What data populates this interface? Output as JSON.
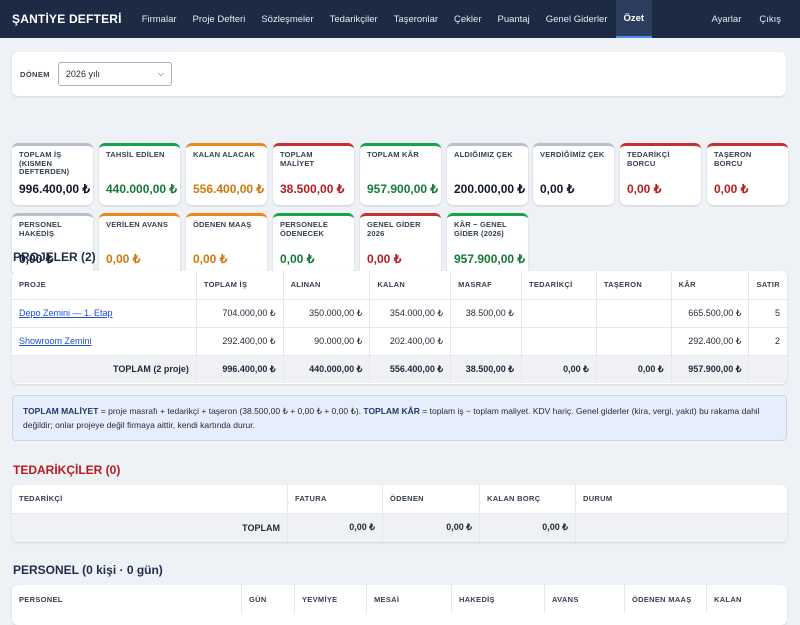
{
  "nav": {
    "brand": "ŞANTİYE DEFTERİ",
    "items": [
      "Firmalar",
      "Proje Defteri",
      "Sözleşmeler",
      "Tedarikçiler",
      "Taşeronlar",
      "Çekler",
      "Puantaj",
      "Genel Giderler",
      "Özet"
    ],
    "active": "Özet",
    "right": [
      "Ayarlar",
      "Çıkış"
    ]
  },
  "filter": {
    "label": "DÖNEM",
    "value": "2026 yılı"
  },
  "stats": [
    {
      "label": "TOPLAM İŞ (KISMEN DEFTERDEN)",
      "value": "996.400,00 ₺",
      "tone": "neutral"
    },
    {
      "label": "TAHSİL EDİLEN",
      "value": "440.000,00 ₺",
      "tone": "green"
    },
    {
      "label": "KALAN ALACAK",
      "value": "556.400,00 ₺",
      "tone": "orange"
    },
    {
      "label": "TOPLAM MALİYET",
      "value": "38.500,00 ₺",
      "tone": "red"
    },
    {
      "label": "TOPLAM KÂR",
      "value": "957.900,00 ₺",
      "tone": "green"
    },
    {
      "label": "ALDIĞIMIZ ÇEK",
      "value": "200.000,00 ₺",
      "tone": "neutral"
    },
    {
      "label": "VERDİĞİMİZ ÇEK",
      "value": "0,00 ₺",
      "tone": "neutral"
    },
    {
      "label": "TEDARİKÇİ BORCU",
      "value": "0,00 ₺",
      "tone": "red"
    },
    {
      "label": "TAŞERON BORCU",
      "value": "0,00 ₺",
      "tone": "red"
    },
    {
      "label": "PERSONEL HAKEDİŞ",
      "value": "0,00 ₺",
      "tone": "neutral"
    },
    {
      "label": "VERİLEN AVANS",
      "value": "0,00 ₺",
      "tone": "orange"
    },
    {
      "label": "ÖDENEN MAAŞ",
      "value": "0,00 ₺",
      "tone": "orange"
    },
    {
      "label": "PERSONELE ÖDENECEK",
      "value": "0,00 ₺",
      "tone": "green"
    },
    {
      "label": "GENEL GİDER 2026",
      "value": "0,00 ₺",
      "tone": "red"
    },
    {
      "label": "KÂR − GENEL GİDER (2026)",
      "value": "957.900,00 ₺",
      "tone": "green"
    }
  ],
  "projects": {
    "title": "PROJELER (2)",
    "columns": [
      "PROJE",
      "TOPLAM İŞ",
      "ALINAN",
      "KALAN",
      "MASRAF",
      "TEDARİKÇİ",
      "TAŞERON",
      "KÂR",
      "SATIR"
    ],
    "rows": [
      [
        "Depo Zemini — 1. Etap",
        "704.000,00 ₺",
        "350.000,00 ₺",
        "354.000,00 ₺",
        "38.500,00 ₺",
        "",
        "",
        "665.500,00 ₺",
        "5"
      ],
      [
        "Showroom Zemini",
        "292.400,00 ₺",
        "90.000,00 ₺",
        "202.400,00 ₺",
        "",
        "",
        "",
        "292.400,00 ₺",
        "2"
      ]
    ],
    "total": [
      "TOPLAM (2 proje)",
      "996.400,00 ₺",
      "440.000,00 ₺",
      "556.400,00 ₺",
      "38.500,00 ₺",
      "0,00 ₺",
      "0,00 ₺",
      "957.900,00 ₺",
      ""
    ]
  },
  "note": {
    "b1": "TOPLAM MALİYET",
    "t1": " = proje masrafı + tedarikçi + taşeron (38.500,00 ₺ + 0,00 ₺ + 0,00 ₺). ",
    "b2": "TOPLAM KÂR",
    "t2": " = toplam iş − toplam maliyet. KDV hariç. Genel giderler (kira, vergi, yakıt) bu rakama dahil değildir; onlar projeye değil firmaya aittir, kendi kartında durur."
  },
  "suppliers": {
    "title": "TEDARİKÇİLER (0)",
    "columns": [
      "TEDARİKÇİ",
      "FATURA",
      "ÖDENEN",
      "KALAN BORÇ",
      "DURUM"
    ],
    "total": [
      "TOPLAM",
      "0,00 ₺",
      "0,00 ₺",
      "0,00 ₺",
      ""
    ]
  },
  "personnel": {
    "title": "PERSONEL (0 kişi · 0 gün)",
    "columns": [
      "PERSONEL",
      "GÜN",
      "YEVMİYE",
      "MESAİ",
      "HAKEDİŞ",
      "AVANS",
      "ÖDENEN MAAŞ",
      "KALAN"
    ]
  }
}
